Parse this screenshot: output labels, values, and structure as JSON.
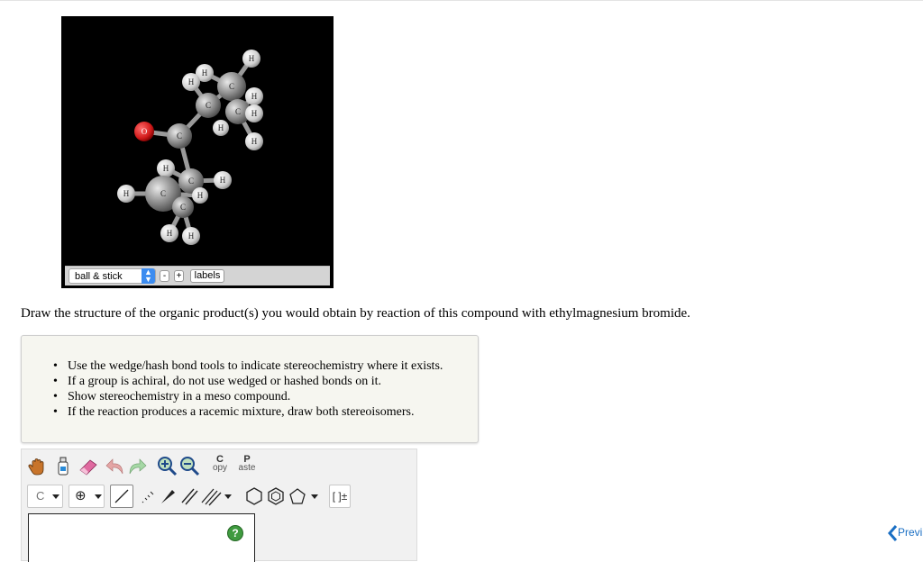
{
  "viewer": {
    "atoms": {
      "hydrogen": "H",
      "carbon": "C",
      "oxygen": "O"
    },
    "style_select": "ball & stick",
    "minus_label": "-",
    "plus_label": "+",
    "labels_button": "labels"
  },
  "question": "Draw the structure of the organic product(s) you would obtain by reaction of this compound with ethylmagnesium bromide.",
  "instructions": [
    "Use the wedge/hash bond tools to indicate stereochemistry where it exists.",
    "If a group is achiral, do not use wedged or hashed bonds on it.",
    "Show stereochemistry in a meso compound.",
    "If the reaction produces a racemic mixture, draw both stereoisomers."
  ],
  "editor": {
    "copy_top": "C",
    "copy_bottom": "opy",
    "paste_top": "P",
    "paste_bottom": "aste",
    "element_label": "C",
    "charge_symbol": "⊕",
    "bracket_label": "[ ]±",
    "help_label": "?",
    "colors": {
      "hand": "#c8742a",
      "eraser": "#e06aa0",
      "help": "#3f9a3f"
    }
  },
  "nav": {
    "prev_label": "Previ"
  }
}
